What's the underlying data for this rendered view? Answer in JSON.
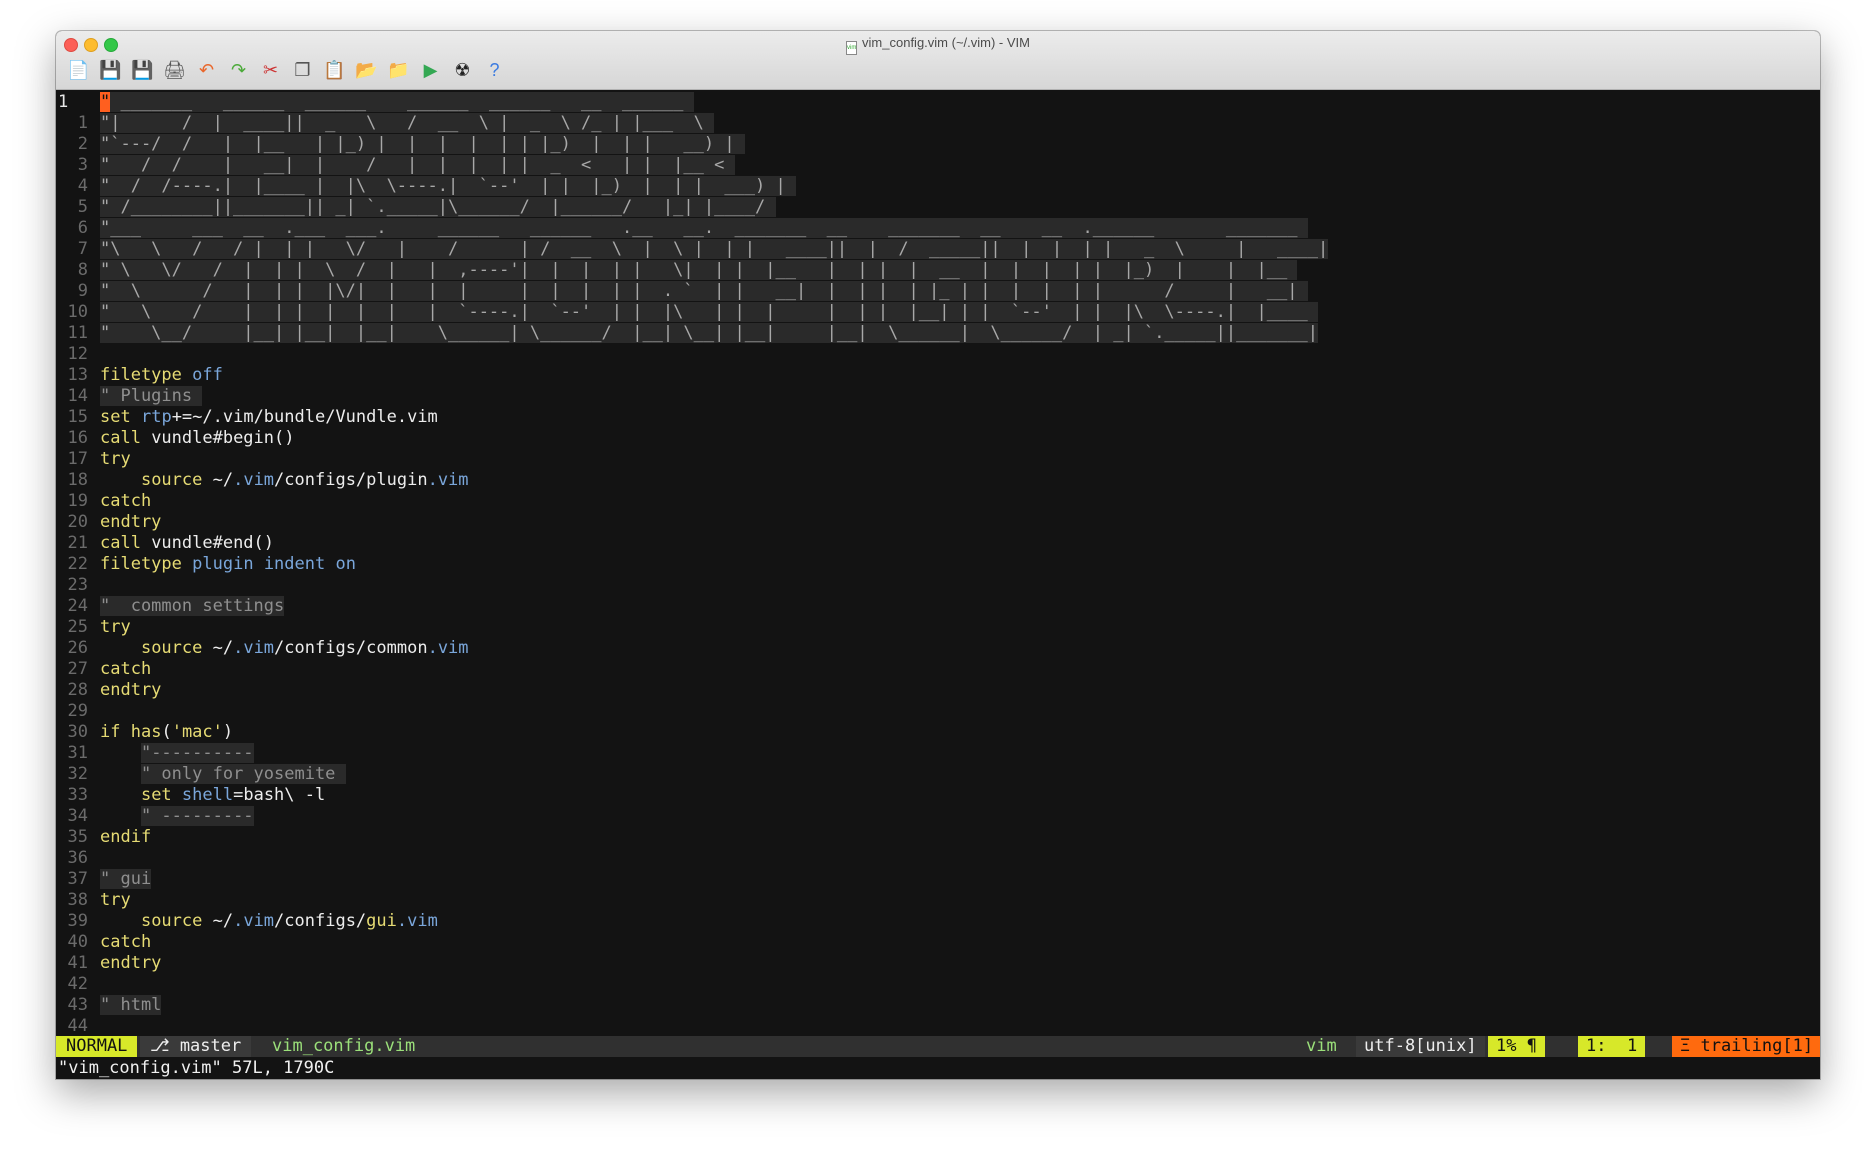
{
  "window": {
    "title": "vim_config.vim (~/.vim) - VIM"
  },
  "toolbar": [
    {
      "name": "open-icon",
      "glyph": "📄"
    },
    {
      "name": "save-icon",
      "glyph": "💾"
    },
    {
      "name": "save-all-icon",
      "glyph": "💾"
    },
    {
      "name": "print-icon",
      "glyph": "🖨"
    },
    {
      "name": "undo-icon",
      "glyph": "↶"
    },
    {
      "name": "redo-icon",
      "glyph": "↷"
    },
    {
      "name": "cut-icon",
      "glyph": "✂"
    },
    {
      "name": "copy-icon",
      "glyph": "❐"
    },
    {
      "name": "paste-icon",
      "glyph": "📋"
    },
    {
      "name": "load-session-icon",
      "glyph": "📂"
    },
    {
      "name": "save-session-icon",
      "glyph": "📁"
    },
    {
      "name": "run-icon",
      "glyph": "▶"
    },
    {
      "name": "make-icon",
      "glyph": "☢"
    },
    {
      "name": "help-icon",
      "glyph": "?"
    }
  ],
  "editor": {
    "cursor_line": "1",
    "lines": [
      {
        "n": "1",
        "segs": [
          {
            "c": "cursor",
            "t": "\""
          },
          {
            "c": "banner",
            "t": " _______   ______  ______    ______  ______   __  ______ "
          }
        ]
      },
      {
        "n": "1",
        "segs": [
          {
            "c": "banner",
            "t": "\"|      /  |  ____||  _   \\   /  __  \\ |  _  \\ /_ | |___  \\ "
          }
        ]
      },
      {
        "n": "2",
        "segs": [
          {
            "c": "banner",
            "t": "\"`---/  /   |  |__   | |_) |  |  |  |  | | |_)  |  | |   __) | "
          }
        ]
      },
      {
        "n": "3",
        "segs": [
          {
            "c": "banner",
            "t": "\"   /  /    |   __|  |    /   |  |  |  | |  _  <   | |  |__ < "
          }
        ]
      },
      {
        "n": "4",
        "segs": [
          {
            "c": "banner",
            "t": "\"  /  /----.|  |____ |  |\\  \\----.|  `--'  | |  |_)  |  | |  ___) | "
          }
        ]
      },
      {
        "n": "5",
        "segs": [
          {
            "c": "banner",
            "t": "\" /________||_______|| _| `._____|\\______/  |______/   |_| |____/ "
          }
        ]
      },
      {
        "n": "6",
        "segs": [
          {
            "c": "banner",
            "t": "\"___     ___  __  .___  ___.     ______   ______   .__   __.  _______  __    _______  __    __  .______       _______ "
          }
        ]
      },
      {
        "n": "7",
        "segs": [
          {
            "c": "banner",
            "t": "\"\\   \\   /   / |  | |   \\/   |    /      | /  __  \\  |  \\ |  | |   ____||  |  /  _____||  |  |  | |   _  \\     |   ____|"
          }
        ]
      },
      {
        "n": "8",
        "segs": [
          {
            "c": "banner",
            "t": "\" \\   \\/   /  |  | |  \\  /  |   |  ,----'|  |  |  | |   \\|  | |  |__   |  | |  |  __  |  |  |  | |  |_)  |    |  |__ "
          }
        ]
      },
      {
        "n": "9",
        "segs": [
          {
            "c": "banner",
            "t": "\"  \\      /   |  | |  |\\/|  |   |  |     |  |  |  | |  . `  | |   __|  |  | |  | |_ | |  |  |  | |      /     |   __| "
          }
        ]
      },
      {
        "n": "10",
        "segs": [
          {
            "c": "banner",
            "t": "\"   \\    /    |  | |  |  |  |   |  `----.|  `--'  | |  |\\   | |  |     |  | |  |__| | |  `--'  | |  |\\  \\----.|  |____ "
          }
        ]
      },
      {
        "n": "11",
        "segs": [
          {
            "c": "banner",
            "t": "\"    \\__/     |__| |__|  |__|    \\______| \\______/  |__| \\__| |__|     |__|  \\______|  \\______/  | _| `._____||_______|"
          }
        ]
      },
      {
        "n": "12",
        "segs": []
      },
      {
        "n": "13",
        "segs": [
          {
            "c": "kw",
            "t": "filetype"
          },
          {
            "c": "plain",
            "t": " "
          },
          {
            "c": "opt",
            "t": "off"
          }
        ]
      },
      {
        "n": "14",
        "segs": [
          {
            "c": "cmt",
            "t": "\" Plugins "
          }
        ]
      },
      {
        "n": "15",
        "segs": [
          {
            "c": "kw",
            "t": "set"
          },
          {
            "c": "plain",
            "t": " "
          },
          {
            "c": "opt",
            "t": "rtp"
          },
          {
            "c": "plain",
            "t": "+=~/.vim/bundle/Vundle.vim"
          }
        ]
      },
      {
        "n": "16",
        "segs": [
          {
            "c": "kw",
            "t": "call"
          },
          {
            "c": "plain",
            "t": " vundle#begin()"
          }
        ]
      },
      {
        "n": "17",
        "segs": [
          {
            "c": "kw",
            "t": "try"
          }
        ]
      },
      {
        "n": "18",
        "segs": [
          {
            "c": "plain",
            "t": "    "
          },
          {
            "c": "kw",
            "t": "source"
          },
          {
            "c": "plain",
            "t": " ~/"
          },
          {
            "c": "vim",
            "t": ".vim"
          },
          {
            "c": "plain",
            "t": "/configs/plugin"
          },
          {
            "c": "vim",
            "t": ".vim"
          }
        ]
      },
      {
        "n": "19",
        "segs": [
          {
            "c": "kw",
            "t": "catch"
          }
        ]
      },
      {
        "n": "20",
        "segs": [
          {
            "c": "kw",
            "t": "endtry"
          }
        ]
      },
      {
        "n": "21",
        "segs": [
          {
            "c": "kw",
            "t": "call"
          },
          {
            "c": "plain",
            "t": " vundle#end()"
          }
        ]
      },
      {
        "n": "22",
        "segs": [
          {
            "c": "kw",
            "t": "filetype"
          },
          {
            "c": "plain",
            "t": " "
          },
          {
            "c": "opt",
            "t": "plugin"
          },
          {
            "c": "plain",
            "t": " "
          },
          {
            "c": "opt",
            "t": "indent"
          },
          {
            "c": "plain",
            "t": " "
          },
          {
            "c": "opt",
            "t": "on"
          }
        ]
      },
      {
        "n": "23",
        "segs": []
      },
      {
        "n": "24",
        "segs": [
          {
            "c": "cmt",
            "t": "\"  common settings"
          }
        ]
      },
      {
        "n": "25",
        "segs": [
          {
            "c": "kw",
            "t": "try"
          }
        ]
      },
      {
        "n": "26",
        "segs": [
          {
            "c": "plain",
            "t": "    "
          },
          {
            "c": "kw",
            "t": "source"
          },
          {
            "c": "plain",
            "t": " ~/"
          },
          {
            "c": "vim",
            "t": ".vim"
          },
          {
            "c": "plain",
            "t": "/configs/common"
          },
          {
            "c": "vim",
            "t": ".vim"
          }
        ]
      },
      {
        "n": "27",
        "segs": [
          {
            "c": "kw",
            "t": "catch"
          }
        ]
      },
      {
        "n": "28",
        "segs": [
          {
            "c": "kw",
            "t": "endtry"
          }
        ]
      },
      {
        "n": "29",
        "segs": []
      },
      {
        "n": "30",
        "segs": [
          {
            "c": "kw",
            "t": "if"
          },
          {
            "c": "plain",
            "t": " "
          },
          {
            "c": "kw",
            "t": "has"
          },
          {
            "c": "plain",
            "t": "("
          },
          {
            "c": "str",
            "t": "'mac'"
          },
          {
            "c": "plain",
            "t": ")"
          }
        ]
      },
      {
        "n": "31",
        "segs": [
          {
            "c": "plain",
            "t": "    "
          },
          {
            "c": "cmt",
            "t": "\"----------"
          }
        ]
      },
      {
        "n": "32",
        "segs": [
          {
            "c": "plain",
            "t": "    "
          },
          {
            "c": "cmt",
            "t": "\" only for yosemite "
          }
        ]
      },
      {
        "n": "33",
        "segs": [
          {
            "c": "plain",
            "t": "    "
          },
          {
            "c": "kw",
            "t": "set"
          },
          {
            "c": "plain",
            "t": " "
          },
          {
            "c": "opt",
            "t": "shell"
          },
          {
            "c": "plain",
            "t": "=bash\\ -l"
          }
        ]
      },
      {
        "n": "34",
        "segs": [
          {
            "c": "plain",
            "t": "    "
          },
          {
            "c": "cmt",
            "t": "\" ---------"
          }
        ]
      },
      {
        "n": "35",
        "segs": [
          {
            "c": "kw",
            "t": "endif"
          }
        ]
      },
      {
        "n": "36",
        "segs": []
      },
      {
        "n": "37",
        "segs": [
          {
            "c": "cmt",
            "t": "\" gui"
          }
        ]
      },
      {
        "n": "38",
        "segs": [
          {
            "c": "kw",
            "t": "try"
          }
        ]
      },
      {
        "n": "39",
        "segs": [
          {
            "c": "plain",
            "t": "    "
          },
          {
            "c": "kw",
            "t": "source"
          },
          {
            "c": "plain",
            "t": " ~/"
          },
          {
            "c": "vim",
            "t": ".vim"
          },
          {
            "c": "plain",
            "t": "/configs/"
          },
          {
            "c": "kw",
            "t": "gui"
          },
          {
            "c": "vim",
            "t": ".vim"
          }
        ]
      },
      {
        "n": "40",
        "segs": [
          {
            "c": "kw",
            "t": "catch"
          }
        ]
      },
      {
        "n": "41",
        "segs": [
          {
            "c": "kw",
            "t": "endtry"
          }
        ]
      },
      {
        "n": "42",
        "segs": []
      },
      {
        "n": "43",
        "segs": [
          {
            "c": "cmt",
            "t": "\" html"
          }
        ]
      },
      {
        "n": "44",
        "segs": []
      }
    ]
  },
  "statusline": {
    "mode": "NORMAL",
    "branch": "⎇ master",
    "file": "vim_config.vim",
    "filetype": "vim",
    "encoding": "utf-8[unix]",
    "percent": "1% ¶",
    "position": "1:  1",
    "trailing": "Ξ trailing[1]"
  },
  "message": "\"vim_config.vim\" 57L, 1790C"
}
